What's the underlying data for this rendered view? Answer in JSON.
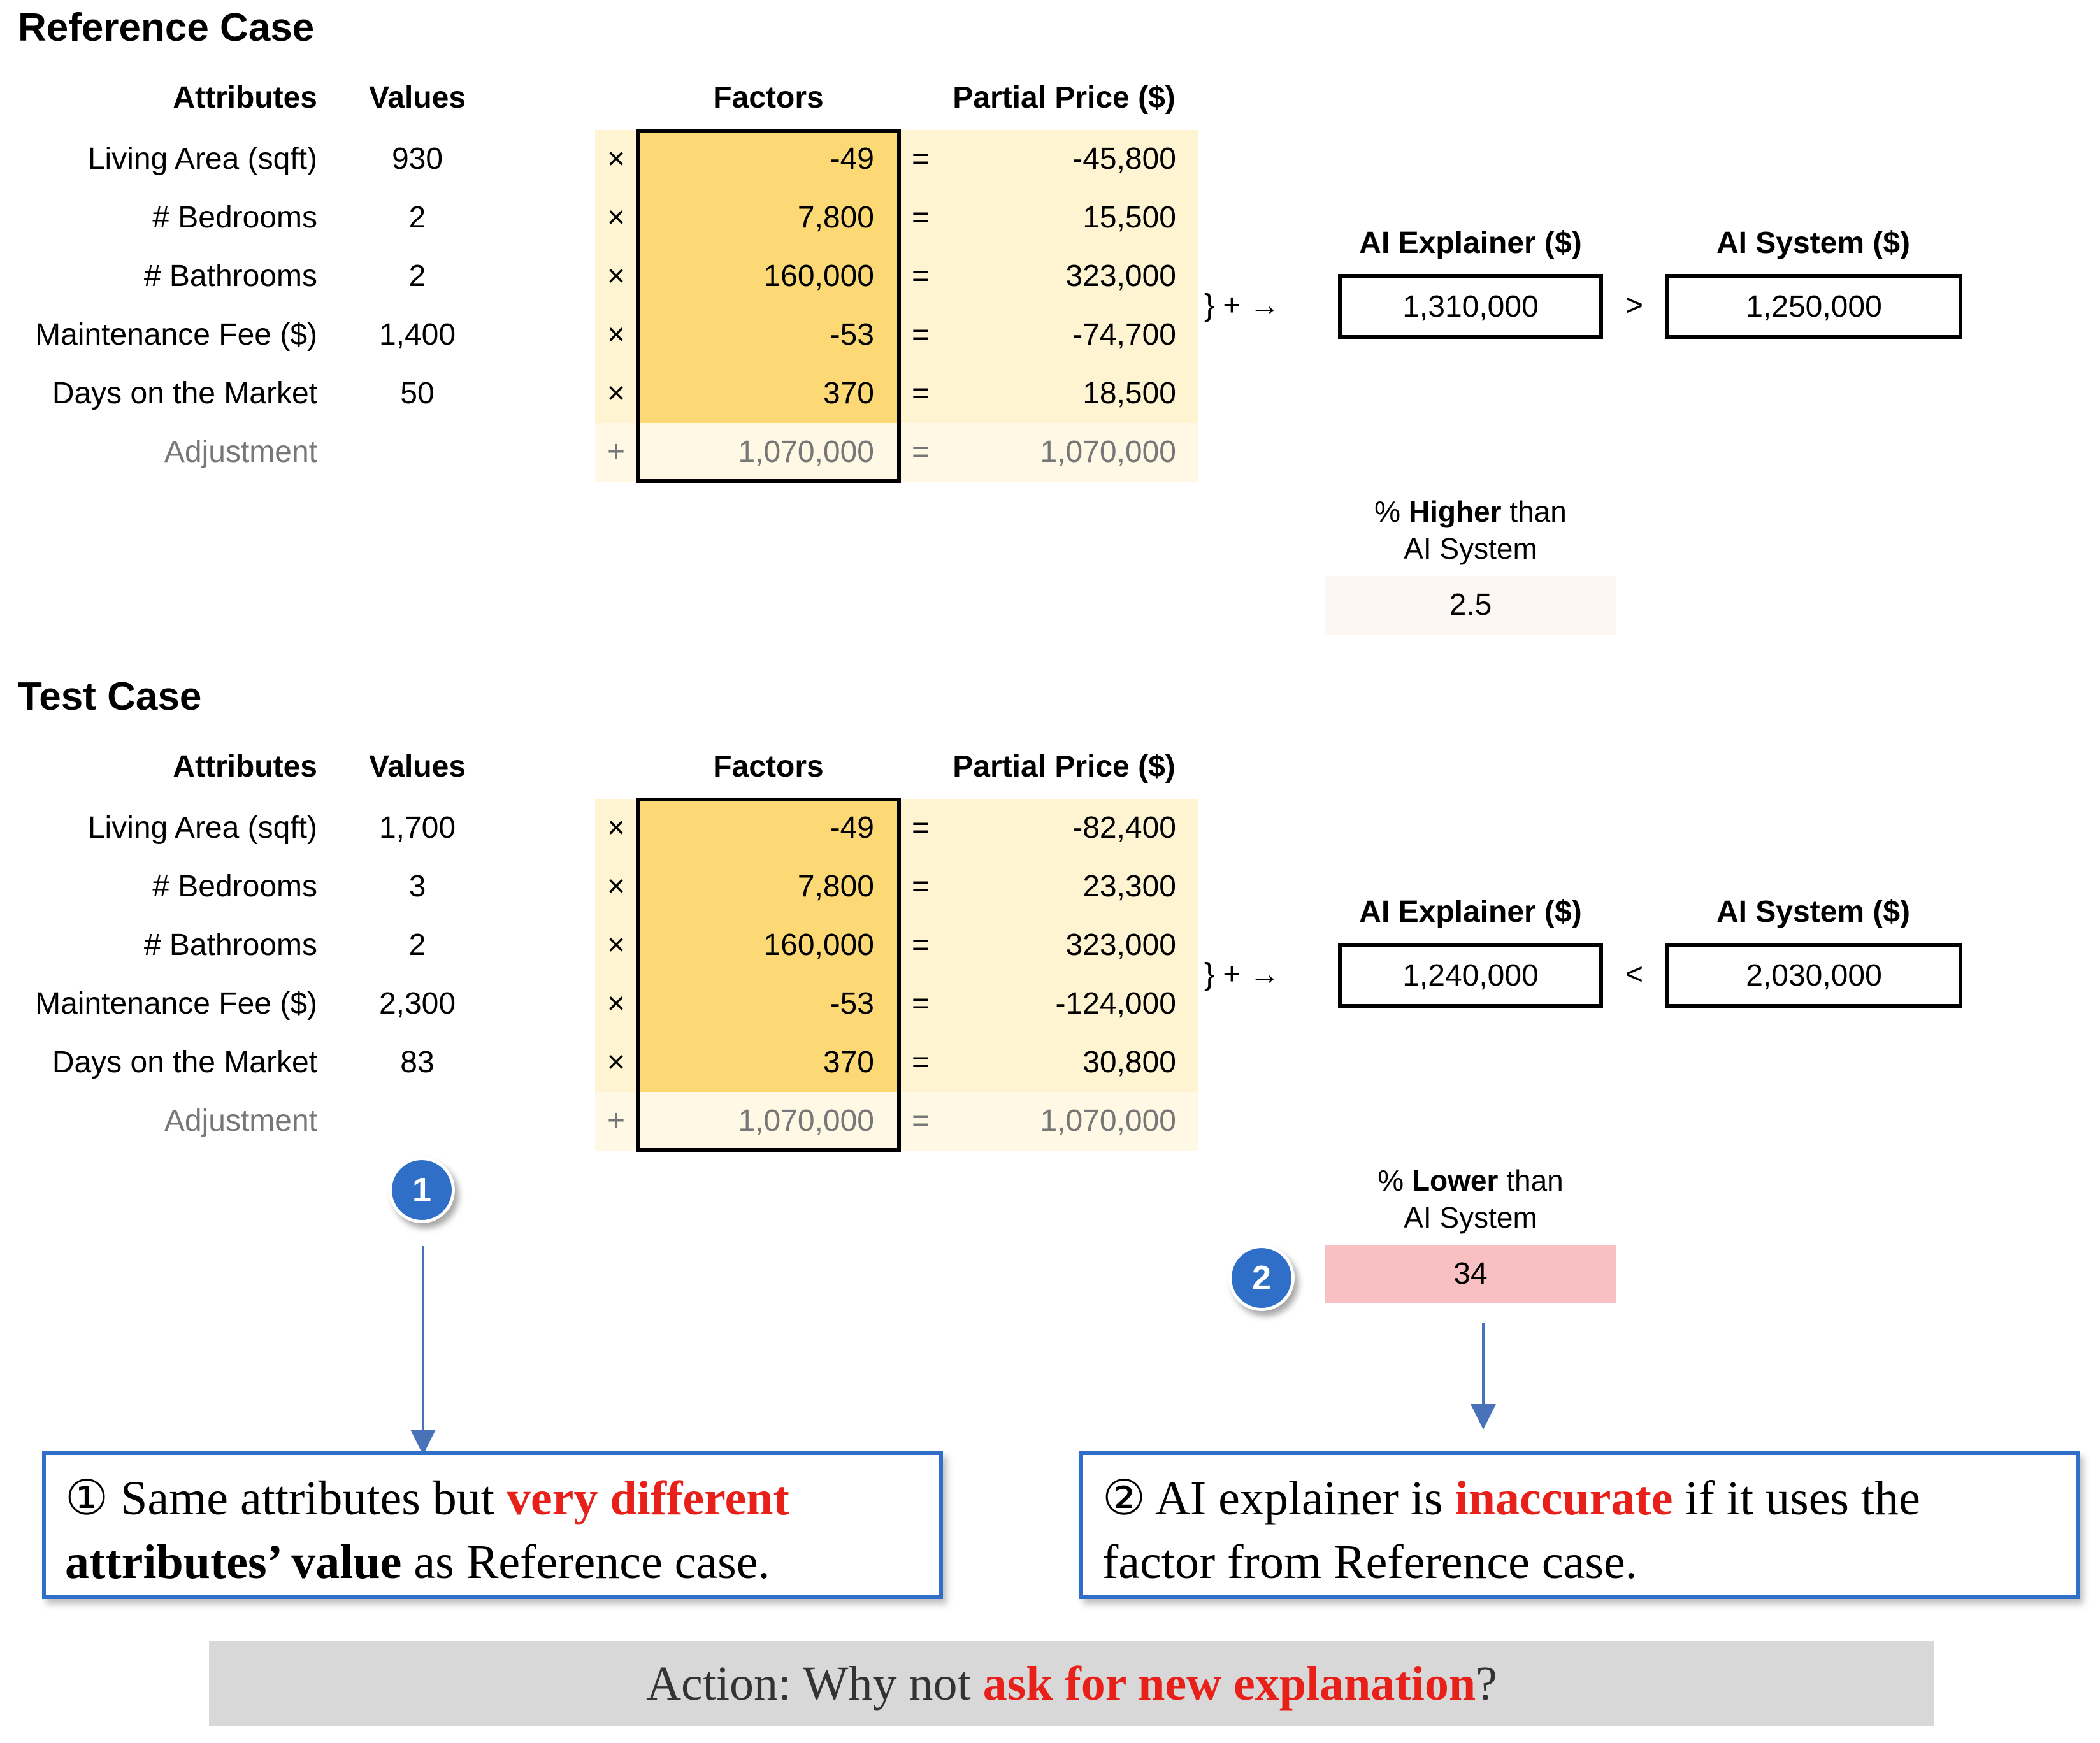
{
  "headers": {
    "attributes": "Attributes",
    "values": "Values",
    "factors": "Factors",
    "partial": "Partial Price ($)",
    "explainer": "AI Explainer ($)",
    "system": "AI System ($)"
  },
  "ops": {
    "times": "×",
    "plus": "+",
    "equals": "=",
    "brace": "} + →"
  },
  "attributes": [
    "Living Area (sqft)",
    "# Bedrooms",
    "# Bathrooms",
    "Maintenance Fee ($)",
    "Days on the Market",
    "Adjustment"
  ],
  "reference": {
    "title": "Reference Case",
    "values": [
      "930",
      "2",
      "2",
      "1,400",
      "50"
    ],
    "factors": [
      "-49",
      "7,800",
      "160,000",
      "-53",
      "370",
      "1,070,000"
    ],
    "partials": [
      "-45,800",
      "15,500",
      "323,000",
      "-74,700",
      "18,500",
      "1,070,000"
    ],
    "explainer": "1,310,000",
    "comparator": ">",
    "system": "1,250,000",
    "pct_prefix": "% ",
    "pct_word": "Higher",
    "pct_suffix": " than",
    "pct_line2": "AI System",
    "pct_value": "2.5"
  },
  "test": {
    "title": "Test Case",
    "values": [
      "1,700",
      "3",
      "2",
      "2,300",
      "83"
    ],
    "factors": [
      "-49",
      "7,800",
      "160,000",
      "-53",
      "370",
      "1,070,000"
    ],
    "partials": [
      "-82,400",
      "23,300",
      "323,000",
      "-124,000",
      "30,800",
      "1,070,000"
    ],
    "explainer": "1,240,000",
    "comparator": "<",
    "system": "2,030,000",
    "pct_prefix": "% ",
    "pct_word": "Lower",
    "pct_suffix": " than",
    "pct_line2": "AI System",
    "pct_value": "34"
  },
  "markers": [
    "1",
    "2"
  ],
  "callouts": {
    "one": {
      "num": "①",
      "t1": " Same attributes but ",
      "r1": "very different",
      "b1": "attributes’ value",
      "t2": " as Reference case."
    },
    "two": {
      "num": "②",
      "t1": " AI explainer is ",
      "r1": "inaccurate",
      "t2": " if it uses the",
      "t3": "factor from Reference case."
    }
  },
  "action": {
    "prefix": "Action: Why not ",
    "emph": "ask for new explanation",
    "suffix": "?"
  },
  "colors": {
    "factor": "#fcd975",
    "partial": "#fff4d2",
    "pct_low": "#f8c0c2",
    "pct_high": "#fdf7f4",
    "accent_red": "#e8201a",
    "marker_blue": "#2f6fc8"
  }
}
